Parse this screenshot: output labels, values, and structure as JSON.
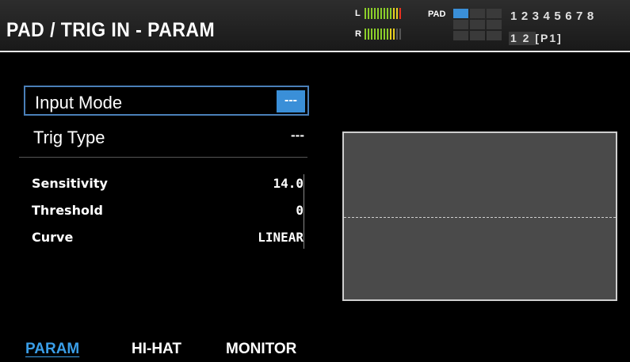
{
  "header": {
    "title": "PAD / TRIG IN - PARAM",
    "meter_l_label": "L",
    "meter_r_label": "R",
    "pad_label": "PAD",
    "trig_numbers": "12345678",
    "bank_numbers": "1 2",
    "pad_id": "[P1]"
  },
  "main": {
    "input_mode_label": "Input Mode",
    "input_mode_value": "---",
    "trig_type_label": "Trig Type",
    "trig_type_value": "---",
    "params": [
      {
        "label": "Sensitivity",
        "value": "14.0"
      },
      {
        "label": "Threshold",
        "value": "0"
      },
      {
        "label": "Curve",
        "value": "LINEAR"
      }
    ]
  },
  "tabs": [
    {
      "label": "PARAM",
      "active": true
    },
    {
      "label": "HI-HAT",
      "active": false
    },
    {
      "label": "MONITOR",
      "active": false
    }
  ],
  "colors": {
    "accent": "#3a8fd8",
    "meter_green": "#8ccf2a",
    "meter_yellow": "#e8d020",
    "meter_red": "#e83020"
  }
}
